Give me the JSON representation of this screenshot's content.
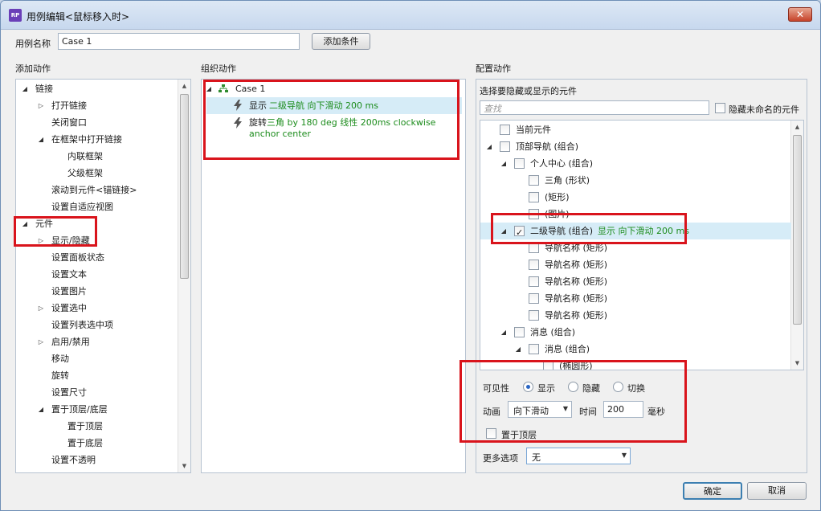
{
  "window": {
    "title": "用例编辑<鼠标移入时>",
    "app_badge": "RP"
  },
  "case_name": {
    "label": "用例名称",
    "value": "Case 1",
    "add_condition": "添加条件"
  },
  "sections": {
    "add_action": "添加动作",
    "organize_action": "组织动作",
    "configure_action": "配置动作"
  },
  "action_tree": [
    {
      "label": "链接",
      "expand": "open",
      "indent": 0
    },
    {
      "label": "打开链接",
      "expand": "closed",
      "indent": 1
    },
    {
      "label": "关闭窗口",
      "expand": "none",
      "indent": 1
    },
    {
      "label": "在框架中打开链接",
      "expand": "open",
      "indent": 1
    },
    {
      "label": "内联框架",
      "expand": "none",
      "indent": 2
    },
    {
      "label": "父级框架",
      "expand": "none",
      "indent": 2
    },
    {
      "label": "滚动到元件<锚链接>",
      "expand": "none",
      "indent": 1
    },
    {
      "label": "设置自适应视图",
      "expand": "none",
      "indent": 1
    },
    {
      "label": "元件",
      "expand": "open",
      "indent": 0
    },
    {
      "label": "显示/隐藏",
      "expand": "closed",
      "indent": 1
    },
    {
      "label": "设置面板状态",
      "expand": "none",
      "indent": 1
    },
    {
      "label": "设置文本",
      "expand": "none",
      "indent": 1
    },
    {
      "label": "设置图片",
      "expand": "none",
      "indent": 1
    },
    {
      "label": "设置选中",
      "expand": "closed",
      "indent": 1
    },
    {
      "label": "设置列表选中项",
      "expand": "none",
      "indent": 1
    },
    {
      "label": "启用/禁用",
      "expand": "closed",
      "indent": 1
    },
    {
      "label": "移动",
      "expand": "none",
      "indent": 1
    },
    {
      "label": "旋转",
      "expand": "none",
      "indent": 1
    },
    {
      "label": "设置尺寸",
      "expand": "none",
      "indent": 1
    },
    {
      "label": "置于顶层/底层",
      "expand": "open",
      "indent": 1
    },
    {
      "label": "置于顶层",
      "expand": "none",
      "indent": 2
    },
    {
      "label": "置于底层",
      "expand": "none",
      "indent": 2
    },
    {
      "label": "设置不透明",
      "expand": "none",
      "indent": 1
    }
  ],
  "organize": {
    "case_label": "Case 1",
    "actions": [
      {
        "verb": "显示",
        "detail": "二级导航 向下滑动 200 ms"
      },
      {
        "verb": "旋转",
        "detail": "三角 by 180 deg 线性 200ms clockwise anchor center"
      }
    ]
  },
  "configure": {
    "header": "选择要隐藏或显示的元件",
    "search_placeholder": "查找",
    "hide_unnamed": "隐藏未命名的元件",
    "elements": [
      {
        "label": "当前元件",
        "expand": "none",
        "indent": 0,
        "checked": false,
        "note": ""
      },
      {
        "label": "顶部导航 (组合)",
        "expand": "open",
        "indent": 0,
        "checked": false,
        "note": ""
      },
      {
        "label": "个人中心 (组合)",
        "expand": "open",
        "indent": 1,
        "checked": false,
        "note": ""
      },
      {
        "label": "三角 (形状)",
        "expand": "none",
        "indent": 2,
        "checked": false,
        "note": ""
      },
      {
        "label": "(矩形)",
        "expand": "none",
        "indent": 2,
        "checked": false,
        "note": ""
      },
      {
        "label": "(图片)",
        "expand": "none",
        "indent": 2,
        "checked": false,
        "note": ""
      },
      {
        "label": "二级导航 (组合)",
        "expand": "open",
        "indent": 1,
        "checked": true,
        "note": "显示 向下滑动 200 ms"
      },
      {
        "label": "导航名称 (矩形)",
        "expand": "none",
        "indent": 2,
        "checked": false,
        "note": ""
      },
      {
        "label": "导航名称 (矩形)",
        "expand": "none",
        "indent": 2,
        "checked": false,
        "note": ""
      },
      {
        "label": "导航名称 (矩形)",
        "expand": "none",
        "indent": 2,
        "checked": false,
        "note": ""
      },
      {
        "label": "导航名称 (矩形)",
        "expand": "none",
        "indent": 2,
        "checked": false,
        "note": ""
      },
      {
        "label": "导航名称 (矩形)",
        "expand": "none",
        "indent": 2,
        "checked": false,
        "note": ""
      },
      {
        "label": "消息 (组合)",
        "expand": "open",
        "indent": 1,
        "checked": false,
        "note": ""
      },
      {
        "label": "消息 (组合)",
        "expand": "open",
        "indent": 2,
        "checked": false,
        "note": ""
      },
      {
        "label": "(椭圆形)",
        "expand": "none",
        "indent": 3,
        "checked": false,
        "note": ""
      }
    ],
    "visibility": {
      "label": "可见性",
      "show": "显示",
      "hide": "隐藏",
      "toggle": "切换",
      "selected": "显示"
    },
    "animation": {
      "label": "动画",
      "value": "向下滑动",
      "time_label": "时间",
      "time_value": "200",
      "unit": "毫秒"
    },
    "bring_front": "置于顶层",
    "more_options": {
      "label": "更多选项",
      "value": "无"
    }
  },
  "footer": {
    "ok": "确定",
    "cancel": "取消"
  }
}
